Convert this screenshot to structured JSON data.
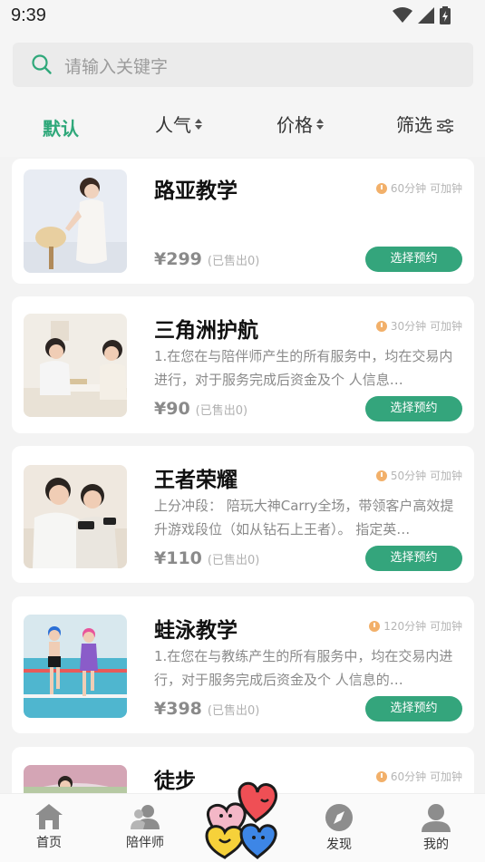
{
  "status": {
    "time": "9:39"
  },
  "search": {
    "placeholder": "请输入关键字"
  },
  "sort": {
    "default": "默认",
    "popularity": "人气",
    "price": "价格",
    "filter": "筛选"
  },
  "items": [
    {
      "title": "路亚教学",
      "duration": "60分钟 可加钟",
      "desc": "",
      "price": "¥299",
      "sold": "(已售出0)",
      "button": "选择预约",
      "image": "woman-portrait"
    },
    {
      "title": "三角洲护航",
      "duration": "30分钟 可加钟",
      "desc": "1.在您在与陪伴师产生的所有服务中，均在交易内进行，对于服务完成后资金及个 人信息…",
      "price": "¥90",
      "sold": "(已售出0)",
      "button": "选择预约",
      "image": "board-game-couple"
    },
    {
      "title": "王者荣耀",
      "duration": "50分钟 可加钟",
      "desc": "上分冲段： 陪玩大神Carry全场，带领客户高效提升游戏段位（如从钻石上王者）。 指定英…",
      "price": "¥110",
      "sold": "(已售出0)",
      "button": "选择预约",
      "image": "mobile-gaming-couple"
    },
    {
      "title": "蛙泳教学",
      "duration": "120分钟 可加钟",
      "desc": "1.在您在与教练产生的所有服务中，均在交易内进行，对于服务完成后资金及个 人信息的…",
      "price": "¥398",
      "sold": "(已售出0)",
      "button": "选择预约",
      "image": "kids-swimming"
    },
    {
      "title": "徒步",
      "duration": "60分钟 可加钟",
      "desc": "",
      "price": "",
      "sold": "",
      "button": "",
      "image": "hiking"
    }
  ],
  "tabbar": {
    "home": "首页",
    "companion": "陪伴师",
    "discover": "发现",
    "mine": "我的"
  },
  "colors": {
    "accent": "#34a57c",
    "activeText": "#2fa87a",
    "clock": "#f2b06a"
  }
}
